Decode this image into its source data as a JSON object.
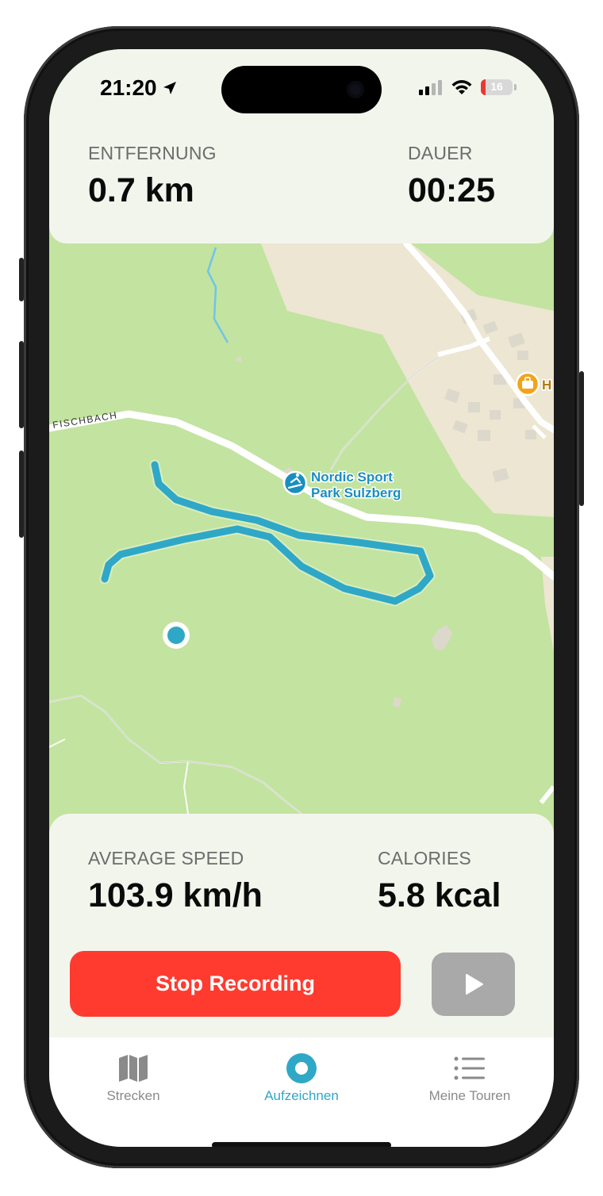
{
  "status_bar": {
    "time": "21:20",
    "battery_level": "16"
  },
  "stats_top": {
    "distance_label": "ENTFERNUNG",
    "distance_value": "0.7 km",
    "duration_label": "DAUER",
    "duration_value": "00:25"
  },
  "map": {
    "road_label": "FISCHBACH",
    "poi_name_line1": "Nordic Sport",
    "poi_name_line2": "Park Sulzberg",
    "partial_poi_label": "H",
    "route_color": "#2fa8c7",
    "poi_color": "#1a8ec0"
  },
  "stats_bottom": {
    "speed_label": "AVERAGE SPEED",
    "speed_value": "103.9 km/h",
    "calories_label": "CALORIES",
    "calories_value": "5.8 kcal"
  },
  "actions": {
    "stop_label": "Stop Recording",
    "stop_color": "#ff3b30",
    "play_icon": "play-icon"
  },
  "tabs": [
    {
      "label": "Strecken",
      "icon": "map-icon",
      "active": false
    },
    {
      "label": "Aufzeichnen",
      "icon": "record-icon",
      "active": true
    },
    {
      "label": "Meine Touren",
      "icon": "list-icon",
      "active": false
    }
  ]
}
